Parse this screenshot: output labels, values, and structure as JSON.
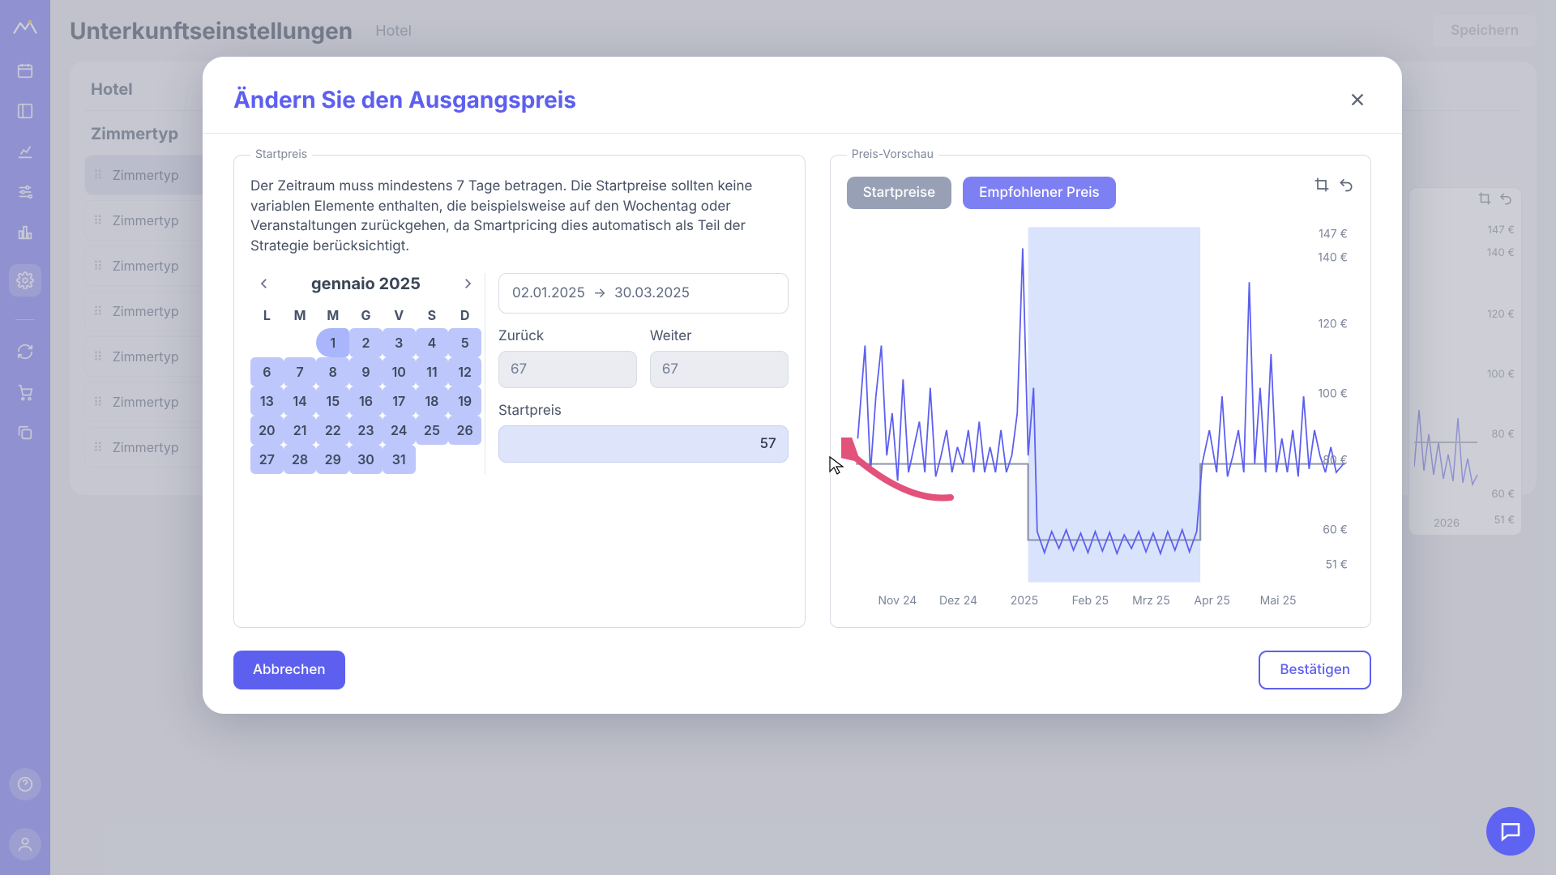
{
  "header": {
    "title": "Unterkunftseinstellungen",
    "subtitle": "Hotel",
    "save": "Speichern"
  },
  "tabs": {
    "hotel": "Hotel",
    "room": "Zimmertyp"
  },
  "roomtypes": [
    "Zimmertyp",
    "Zimmertyp",
    "Zimmertyp",
    "Zimmertyp",
    "Zimmertyp",
    "Zimmertyp",
    "Zimmertyp"
  ],
  "bg_chart": {
    "ylabels": [
      "147 €",
      "140 €",
      "120 €",
      "100 €",
      "80 €",
      "60 €",
      "51 €"
    ],
    "xlabel": "2026"
  },
  "modal": {
    "title": "Ändern Sie den Ausgangspreis",
    "cancel": "Abbrechen",
    "confirm": "Bestätigen",
    "fset1": {
      "legend": "Startpreis",
      "desc": "Der Zeitraum muss mindestens 7 Tage betragen. Die Startpreise sollten keine variablen Elemente enthalten, die beispielsweise auf den Wochentag oder Veranstaltungen zurückgehen, da Smartpricing dies automatisch als Teil der Strategie berücksichtigt."
    },
    "calendar": {
      "month": "gennaio 2025",
      "weekdays": [
        "L",
        "M",
        "M",
        "G",
        "V",
        "S",
        "D"
      ],
      "days": [
        [
          null,
          null,
          1,
          2,
          3,
          4,
          5
        ],
        [
          6,
          7,
          8,
          9,
          10,
          11,
          12
        ],
        [
          13,
          14,
          15,
          16,
          17,
          18,
          19
        ],
        [
          20,
          21,
          22,
          23,
          24,
          25,
          26
        ],
        [
          27,
          28,
          29,
          30,
          31,
          null,
          null
        ]
      ]
    },
    "range": {
      "from": "02.01.2025",
      "arrow": "→",
      "to": "30.03.2025"
    },
    "back": {
      "label": "Zurück",
      "value": "67"
    },
    "fwd": {
      "label": "Weiter",
      "value": "67"
    },
    "sp": {
      "label": "Startpreis",
      "value": "57"
    },
    "fset2": {
      "legend": "Preis-Vorschau",
      "tog_a": "Startpreise",
      "tog_b": "Empfohlener Preis",
      "ylabels": [
        "147 €",
        "140 €",
        "120 €",
        "100 €",
        "80 €",
        "60 €",
        "51 €"
      ],
      "xlabels": [
        "Nov 24",
        "Dez 24",
        "2025",
        "Feb 25",
        "Mrz 25",
        "Apr 25",
        "Mai 25"
      ]
    }
  },
  "chart_data": {
    "type": "line",
    "title": "Preis-Vorschau",
    "ylabel": "€",
    "ylim": [
      51,
      147
    ],
    "x_start": "2024-11",
    "x_end": "2025-05",
    "x_step": "day",
    "series": [
      {
        "name": "Startpreise",
        "baseline": [
          {
            "from": "2024-11",
            "to": "2024-12-31",
            "value": 80
          },
          {
            "from": "2025-01-01",
            "to": "2025-03-30",
            "value": 57
          },
          {
            "from": "2025-03-31",
            "to": "2025-05",
            "value": 80
          }
        ]
      },
      {
        "name": "Empfohlener Preis",
        "approx_peaks": [
          90,
          115,
          85,
          100,
          80,
          95,
          85,
          145,
          98,
          108,
          80,
          60,
          58,
          60,
          62,
          58,
          60,
          90,
          140,
          88,
          110,
          82,
          88
        ]
      }
    ],
    "highlight_range": {
      "from": "2025-01-02",
      "to": "2025-03-30"
    }
  }
}
